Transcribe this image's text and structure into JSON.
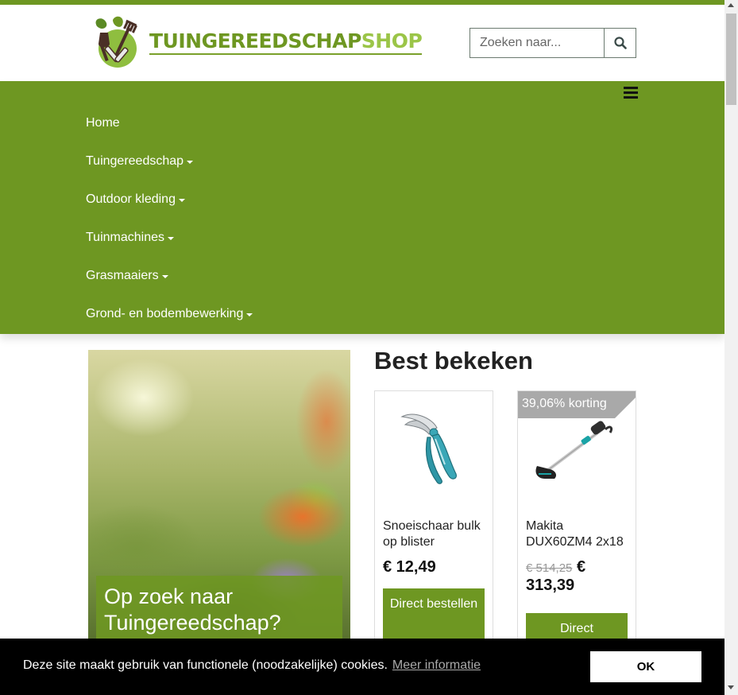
{
  "brand": {
    "logo_text_part1": "TUINGEREEDSCHAP",
    "logo_text_part2": "SHOP",
    "accent_color": "#6e9722"
  },
  "search": {
    "placeholder": "Zoeken naar...",
    "button_icon": "search-icon"
  },
  "nav": {
    "menu_icon": "hamburger-icon",
    "items": [
      {
        "label": "Home",
        "dropdown": false
      },
      {
        "label": "Tuingereedschap",
        "dropdown": true
      },
      {
        "label": "Outdoor kleding",
        "dropdown": true
      },
      {
        "label": "Tuinmachines",
        "dropdown": true
      },
      {
        "label": "Grasmaaiers",
        "dropdown": true
      },
      {
        "label": "Grond- en bodembewerking",
        "dropdown": true
      }
    ]
  },
  "hero": {
    "caption": "Op zoek naar Tuingereedschap?"
  },
  "best_viewed": {
    "title": "Best bekeken",
    "products": [
      {
        "name": "Snoeischaar bulk op blister",
        "price": "€ 12,49",
        "button": "Direct bestellen"
      },
      {
        "badge": "39,06% korting",
        "name": "Makita DUX60ZM4 2x18",
        "old_price": "€ 514,25",
        "currency": "€",
        "price": "313,39",
        "button": "Direct"
      }
    ]
  },
  "cookie": {
    "text": "Deze site maakt gebruik van functionele (noodzakelijke) cookies.",
    "link": "Meer informatie",
    "button": "OK"
  }
}
